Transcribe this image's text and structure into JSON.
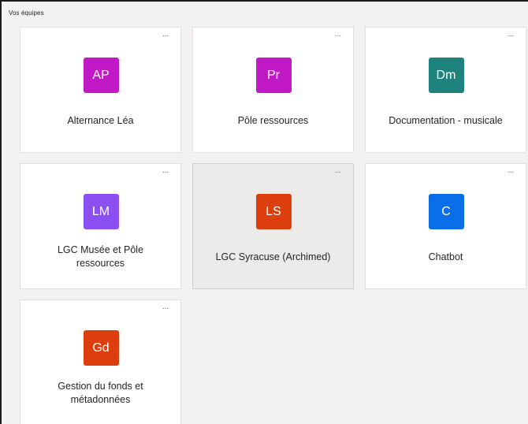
{
  "section": {
    "title": "Vos équipes"
  },
  "more_label": "...",
  "teams": [
    {
      "initials": "AP",
      "name": "Alternance Léa",
      "color": "#c219c6"
    },
    {
      "initials": "Pr",
      "name": "Pôle ressources",
      "color": "#c219c6"
    },
    {
      "initials": "Dm",
      "name": "Documentation - musicale",
      "color": "#1e827d"
    },
    {
      "initials": "LM",
      "name": "LGC Musée et Pôle\nressources",
      "color": "#8c4ff2"
    },
    {
      "initials": "LS",
      "name": "LGC Syracuse (Archimed)",
      "color": "#dc3e0e"
    },
    {
      "initials": "C",
      "name": "Chatbot",
      "color": "#0a6ee8"
    },
    {
      "initials": "Gd",
      "name": "Gestion du fonds et\nmétadonnées",
      "color": "#dc3e0e"
    }
  ]
}
